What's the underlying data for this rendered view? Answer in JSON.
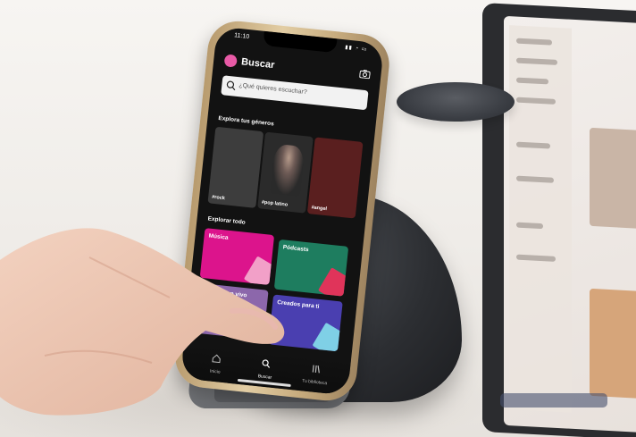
{
  "phone_app": {
    "status": {
      "time": "11:10"
    },
    "header": {
      "title": "Buscar"
    },
    "search": {
      "placeholder": "¿Qué quieres escuchar?"
    },
    "genres": {
      "title": "Explora tus géneros",
      "items": [
        {
          "label": "#rock",
          "color": "#3d3d3d"
        },
        {
          "label": "#pop latino",
          "color": "#2b2b2b"
        },
        {
          "label": "#angel",
          "color": "#5a1f1f"
        }
      ]
    },
    "browse": {
      "title": "Explorar todo",
      "items": [
        {
          "label": "Música",
          "color": "#dc148c"
        },
        {
          "label": "Pódcasts",
          "color": "#1e7d5f"
        },
        {
          "label": "Eventos en vivo",
          "color": "#8c67ab"
        },
        {
          "label": "Creados para ti",
          "color": "#4a3fb0"
        }
      ]
    },
    "bottom_nav": [
      {
        "label": "Inicio",
        "icon": "home-icon"
      },
      {
        "label": "Buscar",
        "icon": "search-icon"
      },
      {
        "label": "Tu biblioteca",
        "icon": "library-icon"
      }
    ]
  }
}
